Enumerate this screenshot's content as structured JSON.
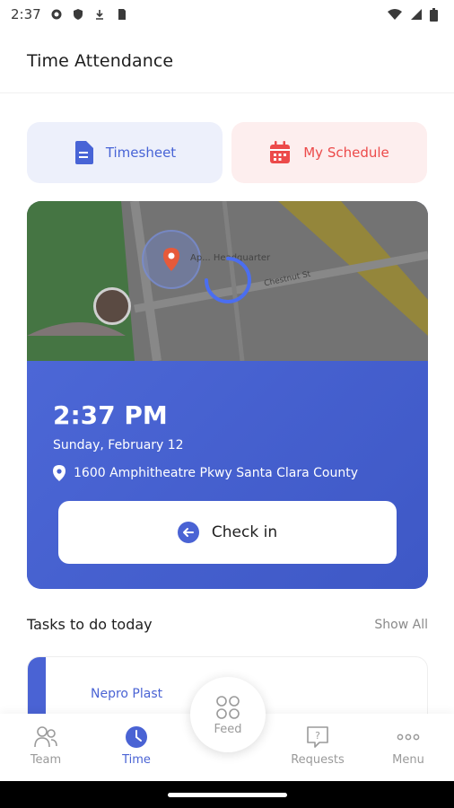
{
  "status_bar": {
    "time": "2:37"
  },
  "header": {
    "title": "Time Attendance"
  },
  "quick_actions": [
    {
      "label": "Timesheet",
      "icon": "document-icon",
      "color": "#4864d6"
    },
    {
      "label": "My Schedule",
      "icon": "calendar-icon",
      "color": "#ec4a4a"
    }
  ],
  "map": {
    "place_label": "Ap... Headquarter",
    "street_label": "Chestnut St",
    "loading": true
  },
  "attendance": {
    "time": "2:37 PM",
    "date": "Sunday, February 12",
    "address": "1600 Amphitheatre Pkwy  Santa Clara County",
    "check_in_label": "Check in"
  },
  "tasks": {
    "title": "Tasks to do today",
    "show_all": "Show All",
    "items": [
      {
        "name": "Nepro Plast"
      }
    ]
  },
  "bottom_nav": {
    "team": "Team",
    "time": "Time",
    "feed": "Feed",
    "requests": "Requests",
    "menu": "Menu"
  },
  "colors": {
    "accent": "#4a63d4",
    "danger": "#ec4a4a"
  }
}
